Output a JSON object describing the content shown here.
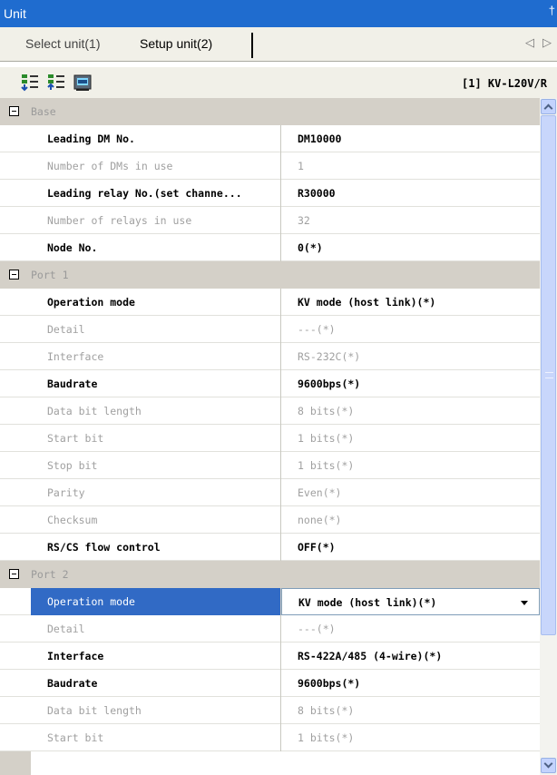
{
  "window": {
    "title": "Unit",
    "pin_glyph": "†"
  },
  "tabs": [
    {
      "label": "Select unit(1)"
    },
    {
      "label": "Setup unit(2)"
    }
  ],
  "tab_nav": {
    "prev": "◁",
    "next": "▷"
  },
  "toolbar": {
    "icons": [
      "expand-properties-icon",
      "collapse-properties-icon",
      "power-supply-icon"
    ],
    "unit_model": "[1] KV-L20V/R"
  },
  "grid": {
    "rows": [
      {
        "kind": "category",
        "label": "Base"
      },
      {
        "kind": "prop",
        "state": "enabled",
        "name": "Leading DM No.",
        "value": "DM10000"
      },
      {
        "kind": "prop",
        "state": "disabled",
        "name": "Number of DMs in use",
        "value": "1"
      },
      {
        "kind": "prop",
        "state": "enabled",
        "name": "Leading relay No.(set channe...",
        "value": "R30000"
      },
      {
        "kind": "prop",
        "state": "disabled",
        "name": "Number of relays in use",
        "value": "32"
      },
      {
        "kind": "prop",
        "state": "enabled",
        "name": "Node No.",
        "value": "0(*)"
      },
      {
        "kind": "category",
        "label": "Port 1"
      },
      {
        "kind": "prop",
        "state": "enabled",
        "name": "Operation mode",
        "value": "KV mode (host link)(*)"
      },
      {
        "kind": "prop",
        "state": "disabled",
        "name": "Detail",
        "value": "---(*)"
      },
      {
        "kind": "prop",
        "state": "disabled",
        "name": "Interface",
        "value": "RS-232C(*)"
      },
      {
        "kind": "prop",
        "state": "enabled",
        "name": "Baudrate",
        "value": "9600bps(*)"
      },
      {
        "kind": "prop",
        "state": "disabled",
        "name": "Data bit length",
        "value": "8 bits(*)"
      },
      {
        "kind": "prop",
        "state": "disabled",
        "name": "Start bit",
        "value": "1 bits(*)"
      },
      {
        "kind": "prop",
        "state": "disabled",
        "name": "Stop bit",
        "value": "1 bits(*)"
      },
      {
        "kind": "prop",
        "state": "disabled",
        "name": "Parity",
        "value": "Even(*)"
      },
      {
        "kind": "prop",
        "state": "disabled",
        "name": "Checksum",
        "value": "none(*)"
      },
      {
        "kind": "prop",
        "state": "enabled",
        "name": "RS/CS flow control",
        "value": "OFF(*)"
      },
      {
        "kind": "category",
        "label": "Port 2"
      },
      {
        "kind": "prop",
        "state": "selected",
        "name": "Operation mode",
        "value": "KV mode (host link)(*)"
      },
      {
        "kind": "prop",
        "state": "disabled",
        "name": "Detail",
        "value": "---(*)"
      },
      {
        "kind": "prop",
        "state": "enabled",
        "name": "Interface",
        "value": "RS-422A/485 (4-wire)(*)"
      },
      {
        "kind": "prop",
        "state": "enabled",
        "name": "Baudrate",
        "value": "9600bps(*)"
      },
      {
        "kind": "prop",
        "state": "disabled",
        "name": "Data bit length",
        "value": "8 bits(*)"
      },
      {
        "kind": "prop",
        "state": "disabled",
        "name": "Start bit",
        "value": "1 bits(*)"
      }
    ]
  },
  "colors": {
    "titlebar": "#1f6ccf",
    "selection": "#316ac5",
    "category_bg": "#d4d0c8",
    "disabled_text": "#a0a0a0"
  }
}
